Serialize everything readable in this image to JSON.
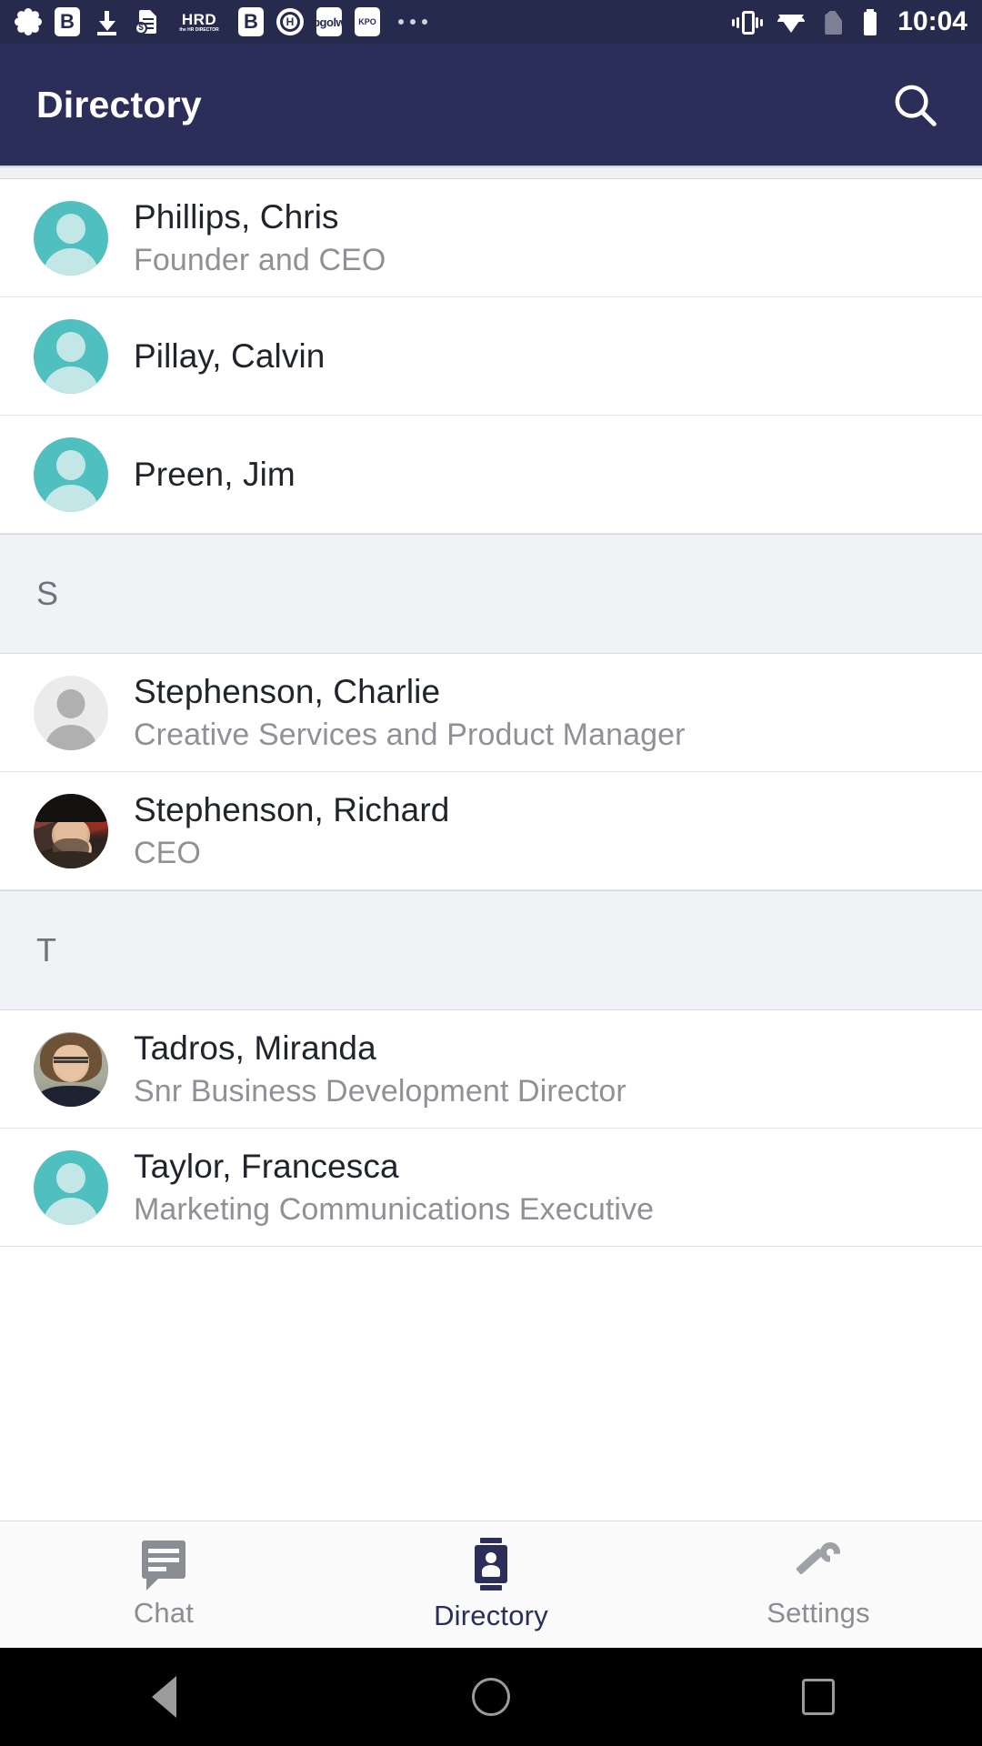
{
  "status_bar": {
    "time": "10:04",
    "left_icons": [
      {
        "name": "slack-icon",
        "label": ""
      },
      {
        "name": "bullhorn-b-app-icon",
        "label": "B"
      },
      {
        "name": "download-icon",
        "label": ""
      },
      {
        "name": "invoice-document-icon",
        "label": "$"
      },
      {
        "name": "hrd-the-hr-director-icon",
        "label": "HRD",
        "sub": "the HR DIRECTOR"
      },
      {
        "name": "b-app-icon",
        "label": "B"
      },
      {
        "name": "h-circle-app-icon",
        "label": "H"
      },
      {
        "name": "apgolwg-app-icon",
        "label": "apgolwg"
      },
      {
        "name": "kpo-app-icon",
        "label": "KPO"
      },
      {
        "name": "more-notifications-icon",
        "label": "..."
      }
    ],
    "right_icons": [
      {
        "name": "vibrate-icon"
      },
      {
        "name": "wifi-icon"
      },
      {
        "name": "no-sim-card-icon"
      },
      {
        "name": "battery-icon"
      }
    ]
  },
  "app_bar": {
    "title": "Directory",
    "search_icon": "search-icon"
  },
  "colors": {
    "app_bar_bg": "#2b2e58",
    "status_bar_bg": "#262a4d",
    "accent": "#2b2e58",
    "avatar_teal": "#4fbfc0",
    "section_header_bg": "#f1f2f6",
    "muted_text": "#8e9196"
  },
  "directory": {
    "sections": [
      {
        "letter": "",
        "show_header": false,
        "contacts": [
          {
            "name": "Phillips, Chris",
            "title": "Founder and CEO",
            "avatar": "placeholder-teal"
          },
          {
            "name": "Pillay, Calvin",
            "title": "",
            "avatar": "placeholder-teal"
          },
          {
            "name": "Preen, Jim",
            "title": "",
            "avatar": "placeholder-teal"
          }
        ]
      },
      {
        "letter": "S",
        "show_header": true,
        "contacts": [
          {
            "name": "Stephenson, Charlie",
            "title": "Creative Services and Product Manager",
            "avatar": "placeholder-gray"
          },
          {
            "name": "Stephenson, Richard",
            "title": "CEO",
            "avatar": "photo-richard"
          }
        ]
      },
      {
        "letter": "T",
        "show_header": true,
        "contacts": [
          {
            "name": "Tadros, Miranda",
            "title": "Snr Business Development Director",
            "avatar": "photo-miranda"
          },
          {
            "name": "Taylor, Francesca",
            "title": "Marketing Communications Executive",
            "avatar": "placeholder-teal"
          }
        ]
      }
    ]
  },
  "bottom_nav": {
    "items": [
      {
        "label": "Chat",
        "icon": "chat-icon",
        "active": false
      },
      {
        "label": "Directory",
        "icon": "directory-card-icon",
        "active": true
      },
      {
        "label": "Settings",
        "icon": "wrench-icon",
        "active": false
      }
    ]
  },
  "android_nav": {
    "back": "back-triangle-icon",
    "home": "home-circle-icon",
    "recents": "recents-square-icon"
  }
}
